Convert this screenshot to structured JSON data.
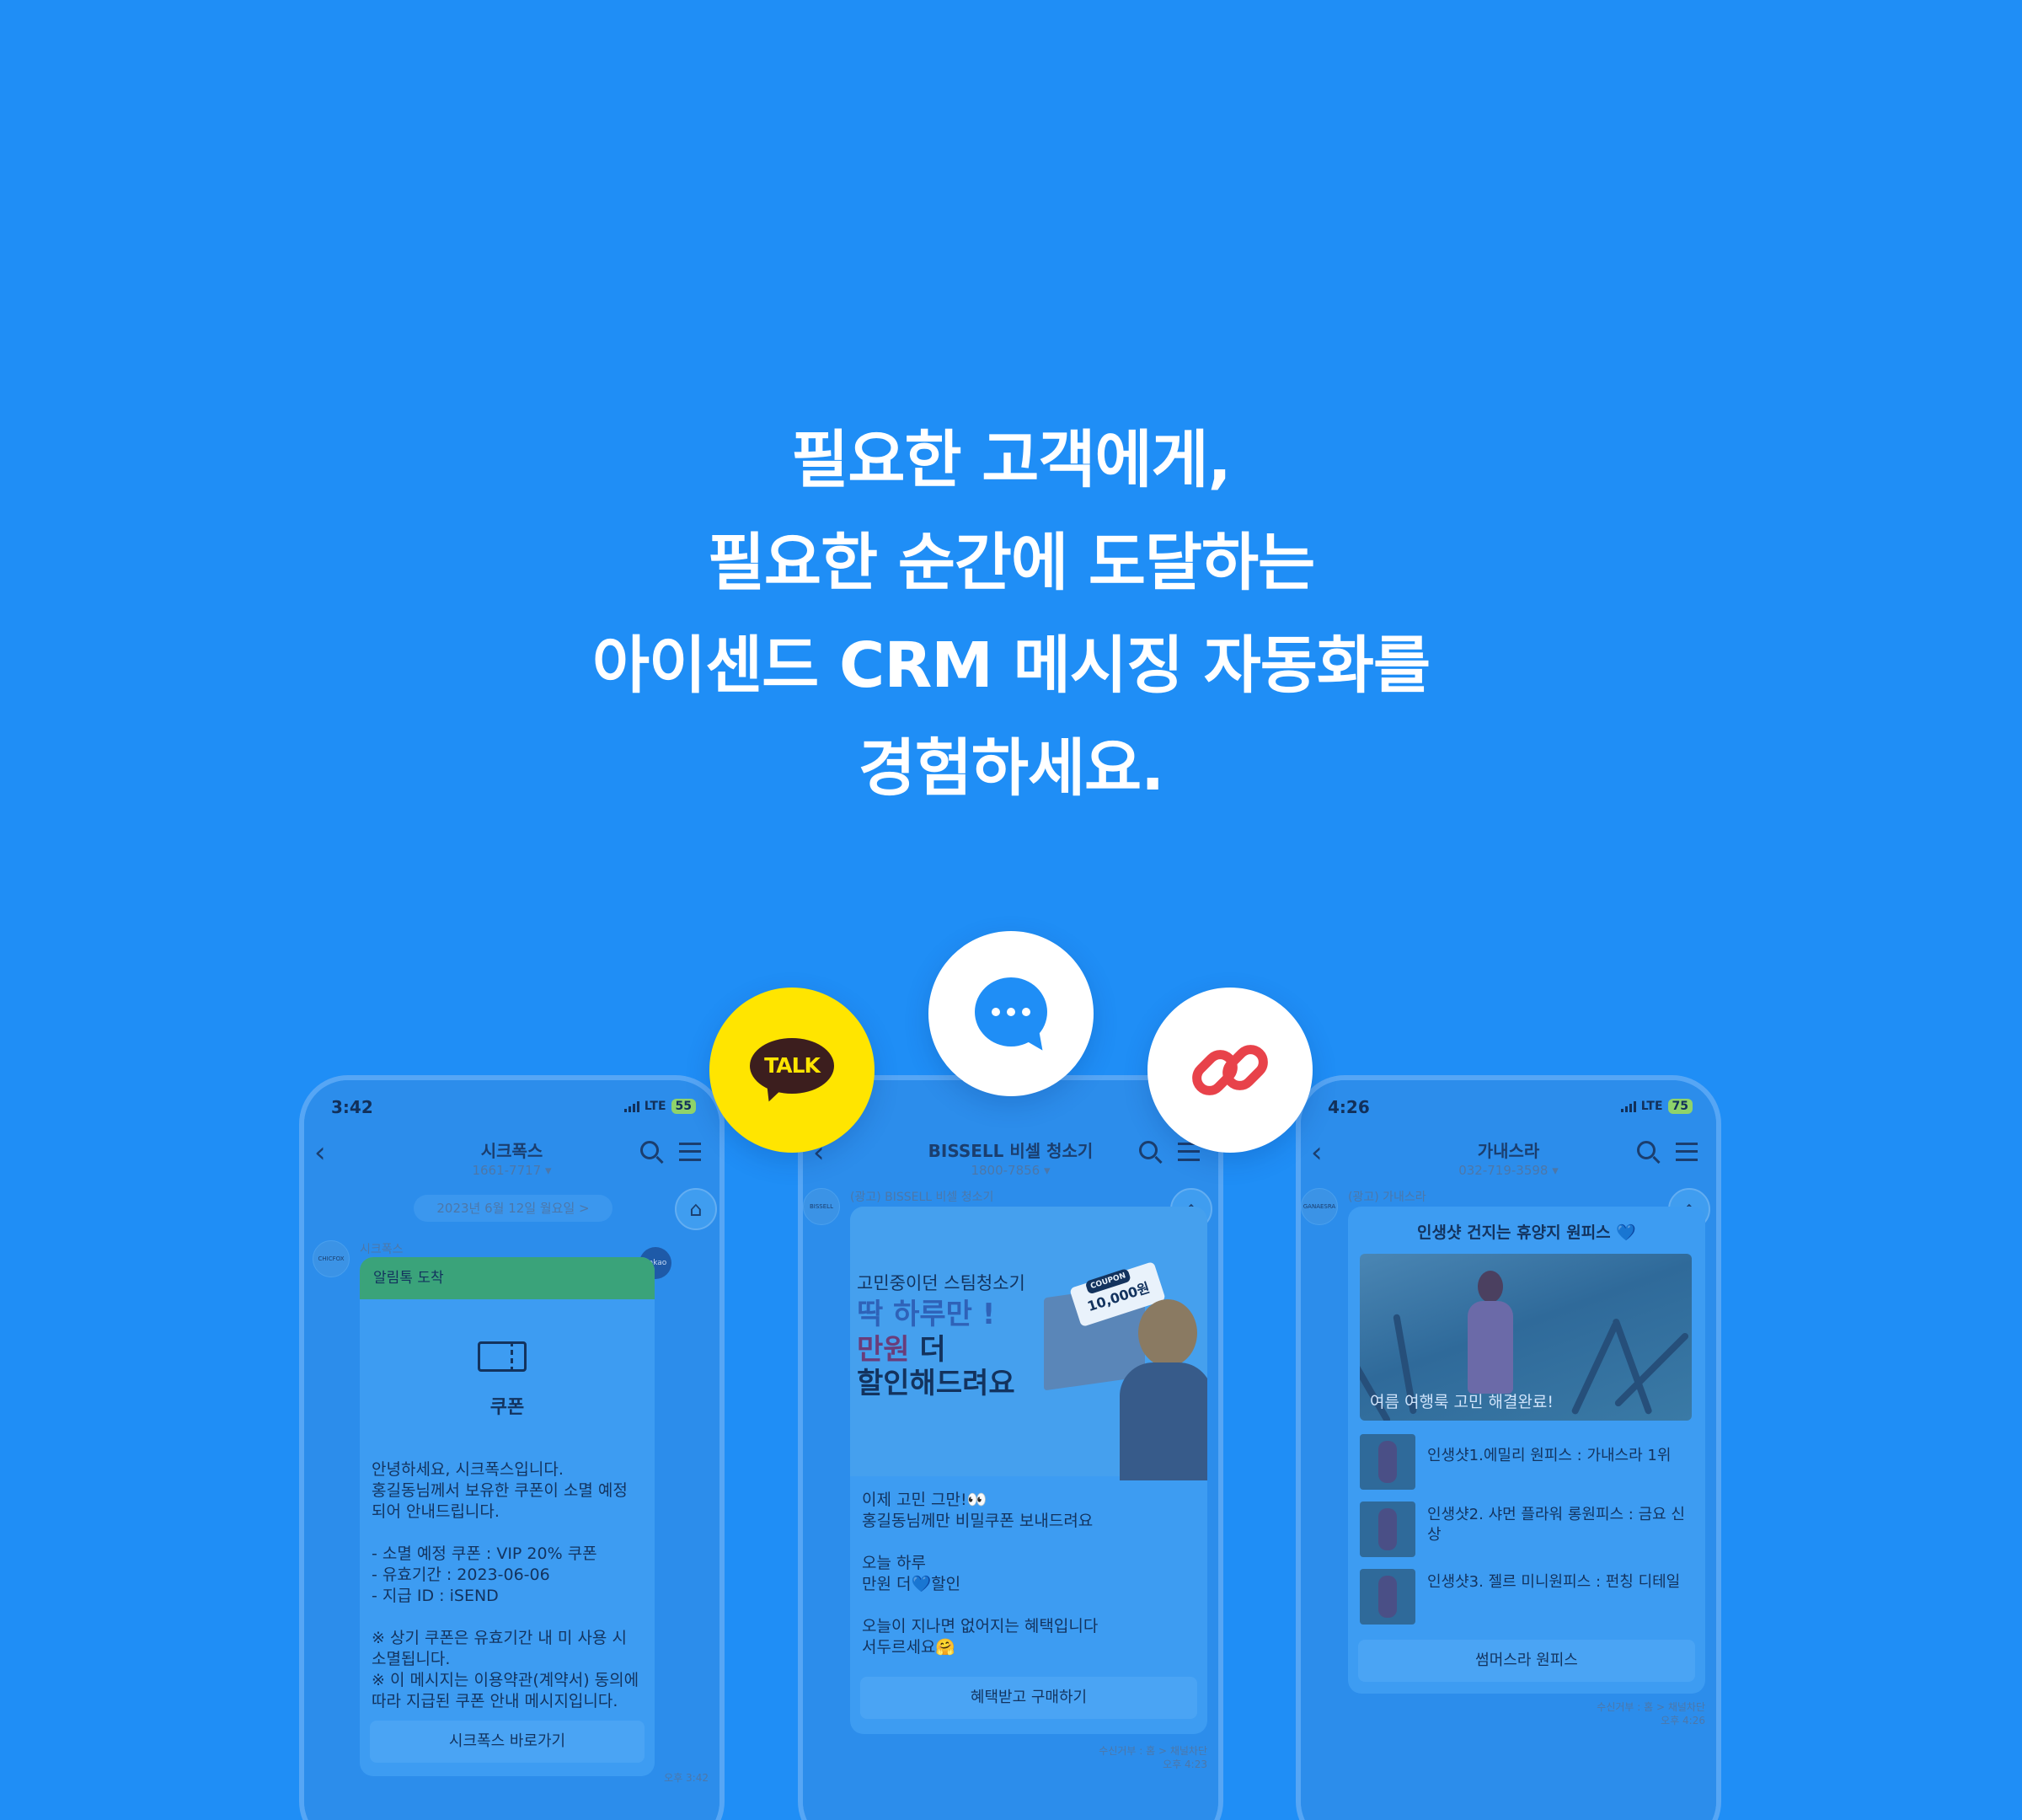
{
  "headline": {
    "line1": "필요한 고객에게,",
    "line2": "필요한 순간에 도달하는",
    "line3": "아이센드 CRM 메시징 자동화를",
    "line4": "경험하세요."
  },
  "icons": {
    "kakao_talk": "TALK",
    "message": "message-bubble-icon",
    "link": "link-icon"
  },
  "colors": {
    "background": "#1f8ef6",
    "kakao_yellow": "#ffe500",
    "link_red": "#e8424a"
  },
  "phone1": {
    "time": "3:42",
    "network": "LTE",
    "battery": "55",
    "channel_name": "시크폭스",
    "channel_phone": "1661-7717 ▾",
    "date_pill": "2023년 6월 12일 월요일 >",
    "sender": "시크폭스",
    "avatar_text": "CHICFOX",
    "badge": "kakao",
    "alim_header": "알림톡 도착",
    "coupon_title": "쿠폰",
    "body_lines": [
      "안녕하세요, 시크폭스입니다.",
      "홍길동님께서 보유한 쿠폰이 소멸 예정",
      "되어 안내드립니다.",
      "",
      "- 소멸 예정 쿠폰 : VIP 20% 쿠폰",
      "- 유효기간 : 2023-06-06",
      "- 지급 ID : iSEND",
      "",
      "※ 상기 쿠폰은 유효기간 내 미 사용 시",
      "소멸됩니다.",
      "※ 이 메시지는 이용약관(계약서) 동의에",
      "따라 지급된 쿠폰 안내 메시지입니다."
    ],
    "button": "시크폭스 바로가기",
    "msg_time": "오후 3:42"
  },
  "phone2": {
    "channel_name": "BISSELL 비셀 청소기",
    "channel_phone": "1800-7856 ▾",
    "sender": "(광고) BISSELL 비셀 청소기",
    "avatar_text": "BISSELL",
    "ad_line1": "고민중이던 스팀청소기",
    "ad_line2": "딱 하루만 !",
    "ad_line3a": "만원",
    "ad_line3b": " 더",
    "ad_line4": "할인해드려요",
    "ad_coupon_tag": "COUPON",
    "ad_coupon_value": "10,000원",
    "body_lines": [
      "이제 고민 그만!👀",
      "홍길동님께만 비밀쿠폰 보내드려요",
      "",
      "오늘 하루",
      "만원 더💙할인",
      "",
      "오늘이 지나면 없어지는 혜택입니다",
      "서두르세요🤗"
    ],
    "button": "혜택받고 구매하기",
    "footer1": "수신거부 : 홈 > 채널차단",
    "msg_time": "오후 4:23"
  },
  "phone3": {
    "time": "4:26",
    "network": "LTE",
    "battery": "75",
    "channel_name": "가내스라",
    "channel_phone": "032-719-3598 ▾",
    "sender": "(광고) 가내스라",
    "avatar_text": "GANAESRA",
    "card_title": "인생샷 건지는 휴양지 원피스 💙",
    "photo_caption": "여름 여행룩 고민 해결완료!",
    "products": [
      {
        "name": "인생샷1.에밀리 원피스 : 가내스라 1위"
      },
      {
        "name": "인생샷2. 샤먼 플라워 롱원피스 : 금요 신상"
      },
      {
        "name": "인생샷3. 젤르 미니원피스 : 펀칭 디테일"
      }
    ],
    "button": "썸머스라 원피스",
    "footer1": "수신거부 : 홈 > 채널차단",
    "msg_time": "오후 4:26"
  }
}
